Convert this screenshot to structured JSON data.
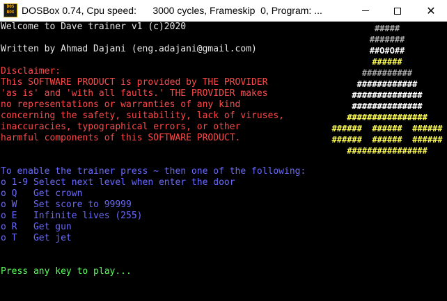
{
  "window": {
    "title": "DOSBox 0.74, Cpu speed:      3000 cycles, Frameskip  0, Program: ...",
    "icon_text_top": "DOS",
    "icon_text_bottom": "BOX",
    "minimize_icon": "minimize-icon",
    "maximize_icon": "maximize-icon",
    "close_glyph": "✕"
  },
  "console": {
    "welcome": "Welcome to Dave trainer v1 (c)2020",
    "author": "Written by Ahmad Dajani (eng.adajani@gmail.com)",
    "disclaimer": [
      "Disclaimer:",
      "This SOFTWARE PRODUCT is provided by THE PROVIDER",
      "'as is' and 'with all faults.' THE PROVIDER makes",
      "no representations or warranties of any kind",
      "concerning the safety, suitability, lack of viruses,",
      "inaccuracies, typographical errors, or other",
      "harmful components of this SOFTWARE PRODUCT."
    ],
    "instructions": "To enable the trainer press ~ then one of the following:",
    "options": [
      "o 1-9 Select next level when enter the door",
      "o Q   Get crown",
      "o W   Set score to 99999",
      "o E   Infinite lives (255)",
      "o R   Get gun",
      "o T   Get jet"
    ],
    "prompt": "Press any key to play..."
  },
  "ascii_art": [
    {
      "text": "#####",
      "color": "gray"
    },
    {
      "text": "#######",
      "color": "gray"
    },
    {
      "text": "##O#O##",
      "color": "white"
    },
    {
      "text": "######",
      "color": "yellow"
    },
    {
      "text": "##########",
      "color": "gray"
    },
    {
      "text": "############",
      "color": "white"
    },
    {
      "text": "##############",
      "color": "white"
    },
    {
      "text": "##############",
      "color": "white"
    },
    {
      "text": "################",
      "color": "yellow"
    },
    {
      "text": "######  ######  ######",
      "color": "yellow"
    },
    {
      "text": "######  ######  ######",
      "color": "yellow"
    },
    {
      "text": "################",
      "color": "yellow"
    }
  ],
  "colors": {
    "background": "#000000",
    "white_text": "#e8e8e8",
    "red_text": "#ff4a4a",
    "blue_text": "#6a6aff",
    "green_text": "#5aff5a",
    "yellow_art": "#ffff55"
  }
}
